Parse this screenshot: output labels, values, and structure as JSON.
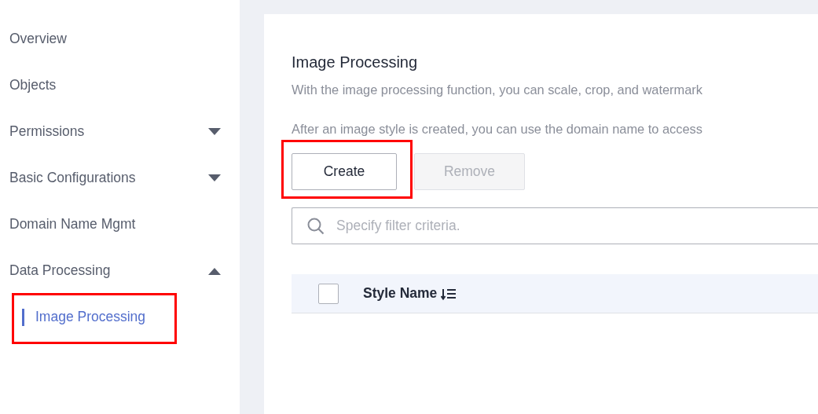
{
  "sidebar": {
    "items": [
      {
        "label": "Overview"
      },
      {
        "label": "Objects"
      },
      {
        "label": "Permissions",
        "expanded": false
      },
      {
        "label": "Basic Configurations",
        "expanded": false
      },
      {
        "label": "Domain Name Mgmt"
      },
      {
        "label": "Data Processing",
        "expanded": true,
        "children": [
          {
            "label": "Image Processing",
            "selected": true,
            "highlighted": true
          }
        ]
      }
    ]
  },
  "main": {
    "title": "Image Processing",
    "descriptions": [
      "With the image processing function, you can scale, crop, and watermark",
      "After an image style is created, you can use the domain name to access"
    ],
    "buttons": [
      {
        "label": "Create",
        "disabled": false,
        "highlighted": true
      },
      {
        "label": "Remove",
        "disabled": true,
        "highlighted": false
      }
    ],
    "search": {
      "placeholder": "Specify filter criteria."
    },
    "table": {
      "select_all": {
        "checked": false
      },
      "columns": [
        {
          "label": "Style Name",
          "sortable": true
        }
      ]
    }
  }
}
